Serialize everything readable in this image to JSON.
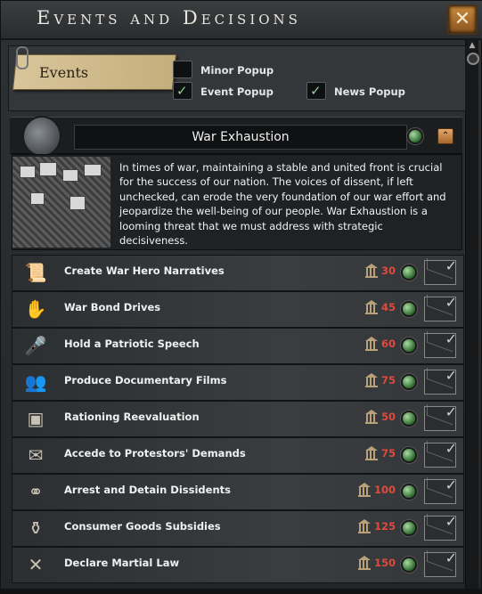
{
  "window": {
    "title": "Events and Decisions",
    "close_icon": "close-icon"
  },
  "filters": {
    "events_label": "Events",
    "options": [
      {
        "label": "Minor Popup",
        "checked": false
      },
      {
        "label": "Event Popup",
        "checked": true
      },
      {
        "label": "News Popup",
        "checked": true
      }
    ]
  },
  "category": {
    "title": "War Exhaustion",
    "icon": "war-exhaustion-icon",
    "description": "In times of war, maintaining a stable and united front is crucial for the success of our nation. The voices of dissent, if left unchecked, can erode the very foundation of our war effort and jeopardize the well-being of our people. War Exhaustion is a looming threat that we must address with strategic decisiveness."
  },
  "decisions": [
    {
      "label": "Create War Hero Narratives",
      "cost": "30",
      "icon": "scroll-icon"
    },
    {
      "label": "War Bond Drives",
      "cost": "45",
      "icon": "hand-icon"
    },
    {
      "label": "Hold a Patriotic Speech",
      "cost": "60",
      "icon": "speaker-icon"
    },
    {
      "label": "Produce Documentary Films",
      "cost": "75",
      "icon": "soldiers-icon"
    },
    {
      "label": "Rationing Reevaluation",
      "cost": "50",
      "icon": "crate-icon"
    },
    {
      "label": "Accede to Protestors' Demands",
      "cost": "75",
      "icon": "document-icon"
    },
    {
      "label": "Arrest and Detain Dissidents",
      "cost": "100",
      "icon": "handcuffs-icon"
    },
    {
      "label": "Consumer Goods Subsidies",
      "cost": "125",
      "icon": "goods-icon"
    },
    {
      "label": "Declare Martial Law",
      "cost": "150",
      "icon": "crossed-rifles-icon"
    }
  ],
  "colors": {
    "cost": "#e04a3c",
    "gem": "#4f9a4b",
    "accent": "#c9893a"
  }
}
